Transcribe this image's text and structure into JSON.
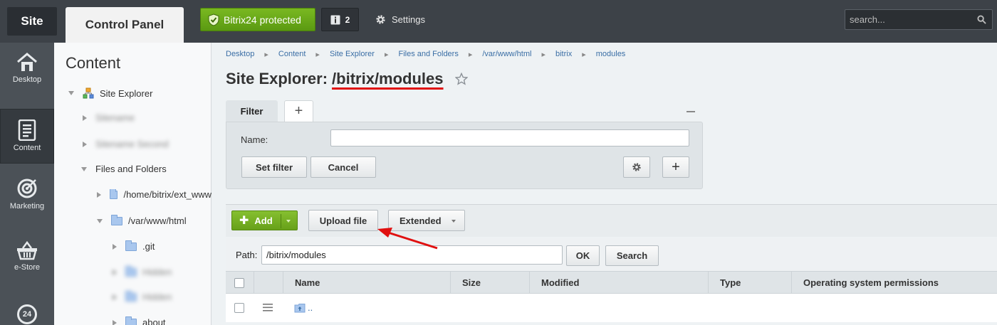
{
  "topbar": {
    "site_label": "Site",
    "control_panel_label": "Control Panel",
    "protected_label": "Bitrix24 protected",
    "notifications_count": "2",
    "settings_label": "Settings",
    "search_placeholder": "search..."
  },
  "sidebar": {
    "items": [
      {
        "label": "Desktop",
        "icon": "home-icon"
      },
      {
        "label": "Content",
        "icon": "document-icon"
      },
      {
        "label": "Marketing",
        "icon": "target-icon"
      },
      {
        "label": "e-Store",
        "icon": "basket-icon"
      },
      {
        "label": "24",
        "icon": "bitrix24-icon"
      }
    ]
  },
  "tree": {
    "title": "Content",
    "site_explorer": "Site Explorer",
    "blurred_1": "Sitename",
    "blurred_2": "Sitename Second",
    "files_and_folders": "Files and Folders",
    "home_folder": "/home/bitrix/ext_www",
    "var_folder": "/var/www/html",
    "git_folder": ".git",
    "blurred_3": "Hidden",
    "blurred_4": "Hidden",
    "about_folder": "about"
  },
  "breadcrumbs": [
    "Desktop",
    "Content",
    "Site Explorer",
    "Files and Folders",
    "/var/www/html",
    "bitrix",
    "modules"
  ],
  "page": {
    "title_prefix": "Site Explorer:",
    "title_path": "/bitrix/modules"
  },
  "filter": {
    "tab_label": "Filter",
    "add_tab": "+",
    "name_label": "Name:",
    "name_value": "",
    "set_filter": "Set filter",
    "cancel": "Cancel",
    "add_field": "+"
  },
  "toolbar": {
    "add_label": "Add",
    "upload_label": "Upload file",
    "extended_label": "Extended"
  },
  "path": {
    "label": "Path:",
    "value": "/bitrix/modules",
    "ok": "OK",
    "search": "Search"
  },
  "grid": {
    "columns": [
      "Name",
      "Size",
      "Modified",
      "Type",
      "Operating system permissions"
    ],
    "rows": [
      {
        "name": ".."
      }
    ]
  },
  "colors": {
    "accent_green": "#6aa41b",
    "annotation_red": "#e01010",
    "link_blue": "#3a6ea5"
  }
}
